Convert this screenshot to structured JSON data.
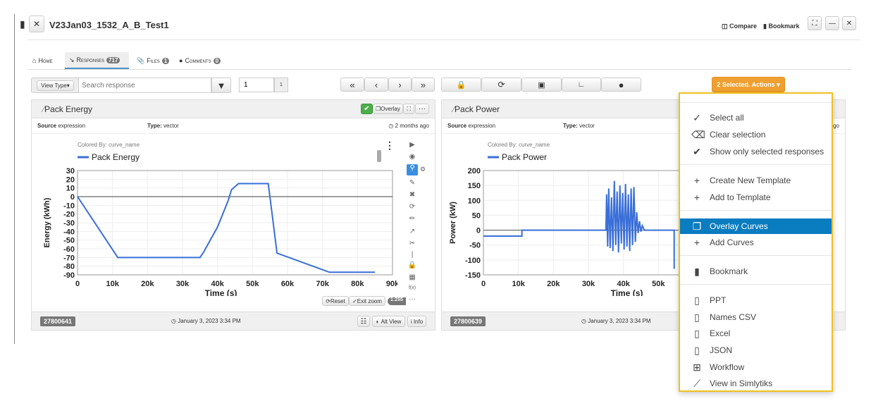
{
  "window": {
    "title": "V23Jan03_1532_A_B_Test1",
    "compare": "Compare",
    "bookmark": "Bookmark"
  },
  "tabs": [
    {
      "label": "Home",
      "icon": "home-icon"
    },
    {
      "label": "Responses",
      "badge": "717",
      "icon": "chart-line-icon"
    },
    {
      "label": "Files",
      "badge": "1",
      "icon": "paperclip-icon"
    },
    {
      "label": "Comments",
      "badge": "0",
      "icon": "comment-icon"
    }
  ],
  "toolbar": {
    "view_type": "View Type",
    "search_placeholder": "Search response",
    "page_value": "1",
    "page_total": "1",
    "actions_label": "2 Selected. Actions",
    "accent": "#f0a030"
  },
  "panels": [
    {
      "title": "Pack Energy",
      "overlay": "Overlay",
      "source_label": "Source",
      "source": "expression",
      "type_label": "Type:",
      "type": "vector",
      "age": "2 months ago",
      "colored_by": "Colored By: curve_name",
      "id": "27800641",
      "date": "January 3, 2023 3:34 PM",
      "reset": "Reset",
      "exit_zoom": "Exit zoom",
      "ratio": "1:255",
      "alt_view": "Alt View",
      "info": "Info"
    },
    {
      "title": "Pack Power",
      "source_label": "Source",
      "source": "expression",
      "type_label": "Type:",
      "type": "vector",
      "age": "go",
      "colored_by": "Colored By: curve_name",
      "id": "27800639",
      "date": "January 3, 2023 3:34 PM"
    }
  ],
  "menu": {
    "items": [
      {
        "label": "Select all",
        "icon": "check-icon"
      },
      {
        "label": "Clear selection",
        "icon": "eraser-icon"
      },
      {
        "label": "Show only selected responses",
        "icon": "check-bold-icon"
      },
      {
        "label": "Create New Template",
        "icon": "plus-icon"
      },
      {
        "label": "Add to Template",
        "icon": "plus-icon"
      },
      {
        "label": "Overlay Curves",
        "icon": "overlay-icon",
        "active": true
      },
      {
        "label": "Add Curves",
        "icon": "plus-icon"
      },
      {
        "label": "Bookmark",
        "icon": "bookmark-icon"
      },
      {
        "label": "PPT",
        "icon": "file-ppt-icon"
      },
      {
        "label": "Names CSV",
        "icon": "file-csv-icon"
      },
      {
        "label": "Excel",
        "icon": "file-excel-icon"
      },
      {
        "label": "JSON",
        "icon": "file-json-icon"
      },
      {
        "label": "Workflow",
        "icon": "sitemap-icon"
      },
      {
        "label": "View in Simlytiks",
        "icon": "chart-line-icon"
      }
    ],
    "active_color": "#0a7cc0"
  },
  "chart_data": [
    {
      "type": "line",
      "xlabel": "Time (s)",
      "ylabel": "Energy (kWh)",
      "xlim": [
        0,
        90000
      ],
      "ylim": [
        -90,
        30
      ],
      "grid": true,
      "legend": "top-left",
      "xticks": [
        "0",
        "10k",
        "20k",
        "30k",
        "40k",
        "50k",
        "60k",
        "70k",
        "80k",
        "90k"
      ],
      "yticks": [
        "30",
        "20",
        "10",
        "0",
        "-10",
        "-20",
        "-30",
        "-40",
        "-50",
        "-60",
        "-70",
        "-80",
        "-90"
      ],
      "series": [
        {
          "name": "Pack Energy",
          "color": "#3a6fd8",
          "x": [
            0,
            11500,
            35000,
            36000,
            40000,
            43000,
            44000,
            46000,
            54500,
            57000,
            72000,
            85000
          ],
          "y": [
            0,
            -70,
            -70,
            -64,
            -35,
            -5,
            8,
            15,
            15,
            -65,
            -87,
            -87
          ]
        }
      ]
    },
    {
      "type": "line",
      "xlabel": "Time (s)",
      "ylabel": "Power (kW)",
      "xlim": [
        0,
        90000
      ],
      "ylim": [
        -150,
        200
      ],
      "grid": true,
      "legend": "top-left",
      "xticks": [
        "0",
        "10k",
        "20k",
        "30k",
        "40k",
        "50k"
      ],
      "yticks": [
        "200",
        "150",
        "100",
        "50",
        "0",
        "-50",
        "-100",
        "-150"
      ],
      "series": [
        {
          "name": "Pack Power",
          "color": "#3a6fd8",
          "x": [
            0,
            11000,
            11000,
            35000,
            35200,
            35500,
            35800,
            36200,
            36600,
            37000,
            37400,
            37800,
            38200,
            38600,
            39000,
            39400,
            39800,
            40200,
            40600,
            41000,
            41400,
            41800,
            42200,
            42600,
            43000,
            43400,
            43800,
            44200,
            44600,
            45000,
            45400,
            46000,
            54500,
            54500
          ],
          "y": [
            -20,
            -20,
            0,
            0,
            120,
            -55,
            140,
            -60,
            110,
            -70,
            165,
            -50,
            130,
            -75,
            150,
            -45,
            125,
            -65,
            155,
            -55,
            120,
            -70,
            140,
            -50,
            145,
            -40,
            60,
            -10,
            30,
            -5,
            15,
            0,
            0,
            -130
          ]
        }
      ]
    }
  ]
}
